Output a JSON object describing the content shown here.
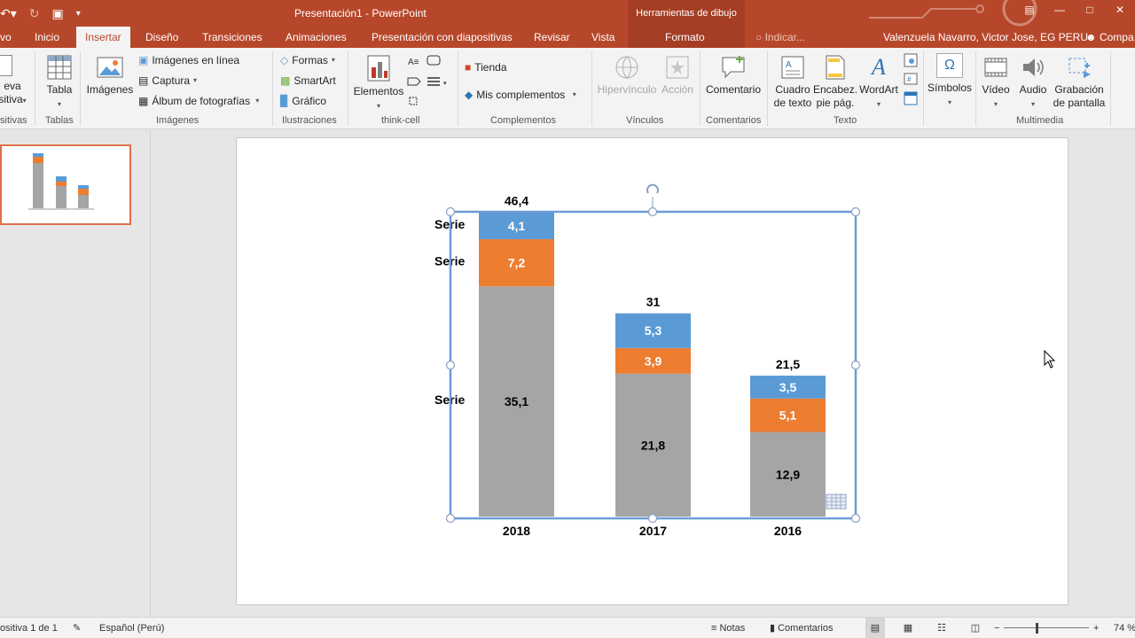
{
  "titlebar": {
    "doc_title": "Presentación1 - PowerPoint",
    "tools_context": "Herramientas de dibujo"
  },
  "tabs": {
    "file_partial": "vo",
    "home": "Inicio",
    "insert": "Insertar",
    "design": "Diseño",
    "transitions": "Transiciones",
    "animations": "Animaciones",
    "slideshow": "Presentación con diapositivas",
    "review": "Revisar",
    "view": "Vista",
    "format": "Formato",
    "tell_me": "Indicar...",
    "user": "Valenzuela Navarro, Victor Jose, EG PERU",
    "share": "Compa"
  },
  "ribbon": {
    "new_slide_line1": "eva",
    "new_slide_line2": "sitiva",
    "group_slides": "sitivas",
    "table": "Tabla",
    "group_tables": "Tablas",
    "images": "Imágenes",
    "online_images": "Imágenes en línea",
    "screenshot": "Captura",
    "photo_album": "Álbum de fotografías",
    "group_images": "Imágenes",
    "shapes": "Formas",
    "smartart": "SmartArt",
    "chart": "Gráfico",
    "group_illustrations": "Ilustraciones",
    "elements": "Elementos",
    "group_thinkcell": "think-cell",
    "store": "Tienda",
    "my_addins": "Mis complementos",
    "group_addins": "Complementos",
    "hyperlink": "Hipervínculo",
    "action": "Acción",
    "group_links": "Vínculos",
    "comment": "Comentario",
    "group_comments": "Comentarios",
    "textbox_l1": "Cuadro",
    "textbox_l2": "de texto",
    "header_l1": "Encabez.",
    "header_l2": "pie pág.",
    "wordart": "WordArt",
    "group_text": "Texto",
    "symbols": "Símbolos",
    "video": "Vídeo",
    "audio": "Audio",
    "screenrec_l1": "Grabación",
    "screenrec_l2": "de pantalla",
    "group_media": "Multimedia"
  },
  "status": {
    "slide_count": "ositiva 1 de 1",
    "language": "Español (Perú)",
    "notes": "Notas",
    "comments": "Comentarios",
    "zoom": "74 %"
  },
  "colors": {
    "accent": "#b7472a",
    "series_blue": "#5b9bd5",
    "series_orange": "#ed7d31",
    "series_gray": "#a5a5a5"
  },
  "chart_data": {
    "type": "bar",
    "stacked": true,
    "categories": [
      "2018",
      "2017",
      "2016"
    ],
    "series": [
      {
        "values": [
          35.1,
          21.8,
          12.9
        ],
        "labels": [
          "35,1",
          "21,8",
          "12,9"
        ]
      },
      {
        "values": [
          7.2,
          3.9,
          5.1
        ],
        "labels": [
          "7,2",
          "3,9",
          "5,1"
        ]
      },
      {
        "values": [
          4.1,
          5.3,
          3.5
        ],
        "labels": [
          "4,1",
          "5,3",
          "3,5"
        ]
      }
    ],
    "totals": [
      "46,4",
      "31",
      "21,5"
    ],
    "series_labels": [
      "Serie",
      "Serie",
      "Serie"
    ]
  }
}
